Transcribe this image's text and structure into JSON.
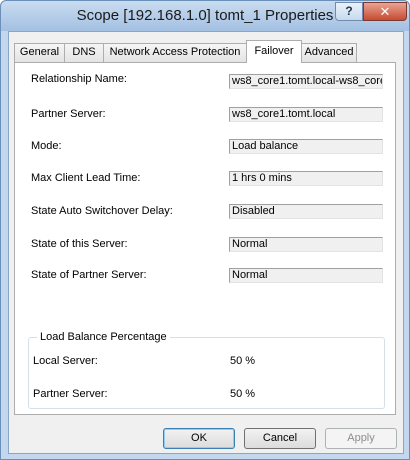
{
  "window": {
    "title": "Scope [192.168.1.0] tomt_1 Properties",
    "help_label": "?",
    "close_label": "✕"
  },
  "tabs": [
    {
      "label": "General",
      "active": false
    },
    {
      "label": "DNS",
      "active": false
    },
    {
      "label": "Network Access Protection",
      "active": false
    },
    {
      "label": "Failover",
      "active": true
    },
    {
      "label": "Advanced",
      "active": false
    }
  ],
  "fields": [
    {
      "label": "Relationship Name:",
      "value": "ws8_core1.tomt.local-ws8_core..."
    },
    {
      "label": "Partner Server:",
      "value": "ws8_core1.tomt.local"
    },
    {
      "label": "Mode:",
      "value": "Load balance"
    },
    {
      "label": "Max Client Lead Time:",
      "value": "1 hrs 0 mins"
    },
    {
      "label": "State Auto Switchover Delay:",
      "value": "Disabled"
    },
    {
      "label": "State of this Server:",
      "value": "Normal"
    },
    {
      "label": "State of Partner Server:",
      "value": "Normal"
    }
  ],
  "load_balance": {
    "title": "Load Balance Percentage",
    "local_label": "Local Server:",
    "local_value": "50 %",
    "partner_label": "Partner Server:",
    "partner_value": "50 %"
  },
  "buttons": {
    "ok": "OK",
    "cancel": "Cancel",
    "apply": "Apply"
  }
}
